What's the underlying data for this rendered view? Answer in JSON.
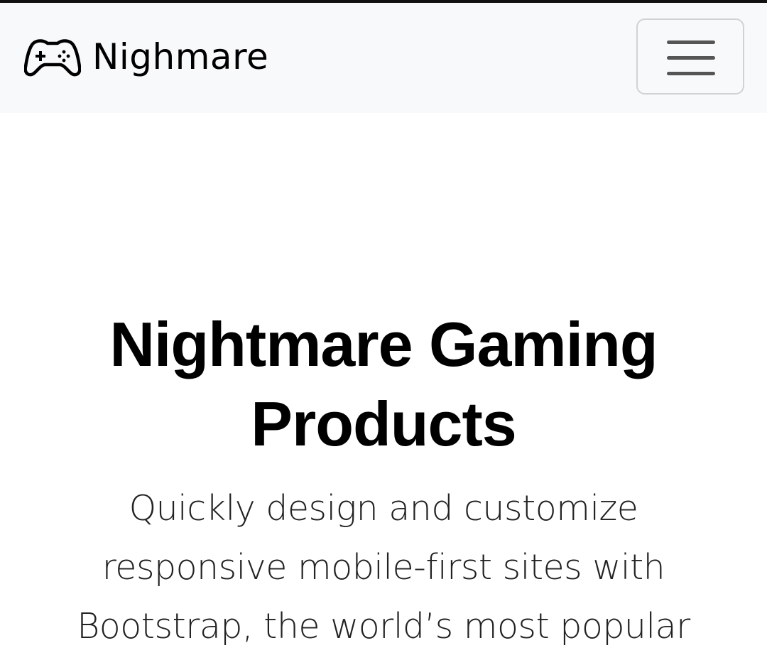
{
  "navbar": {
    "brand": {
      "icon": "gamepad-icon",
      "text": "Nighmare"
    },
    "toggler": {
      "icon": "hamburger-menu-icon"
    }
  },
  "hero": {
    "title": "Nightmare Gaming Products",
    "lead": "Quickly design and customize responsive mobile-first sites with Bootstrap, the world’s most popular"
  },
  "colors": {
    "navbar_bg": "#f8f9fa",
    "text": "#000000",
    "toggler_border": "#d0d2d4"
  }
}
